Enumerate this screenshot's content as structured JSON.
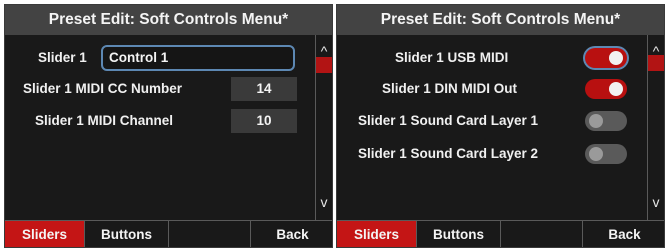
{
  "left_screen": {
    "title": "Preset Edit: Soft Controls Menu*",
    "name_label": "Slider 1",
    "name_value": "Control 1",
    "cc_label": "Slider 1 MIDI CC Number",
    "cc_value": "14",
    "channel_label": "Slider 1 MIDI Channel",
    "channel_value": "10",
    "scroll_up": "^",
    "scroll_down": "v",
    "footer": [
      "Sliders",
      "Buttons",
      "",
      "Back"
    ]
  },
  "right_screen": {
    "title": "Preset Edit: Soft Controls Menu*",
    "settings": [
      {
        "label": "Slider 1 USB MIDI",
        "on": true
      },
      {
        "label": "Slider 1 DIN MIDI Out",
        "on": true
      },
      {
        "label": "Slider 1 Sound Card Layer 1",
        "on": false
      },
      {
        "label": "Slider 1 Sound Card Layer 2",
        "on": false
      }
    ],
    "scroll_up": "^",
    "scroll_down": "v",
    "footer": [
      "Sliders",
      "Buttons",
      "",
      "Back"
    ]
  },
  "colors": {
    "accent_red": "#c41515",
    "focus_blue": "#5d88b3",
    "title_bar": "#434343",
    "background": "#191919"
  },
  "icons": {
    "scroll_up": "chevron-up-icon",
    "scroll_down": "chevron-down-icon"
  }
}
